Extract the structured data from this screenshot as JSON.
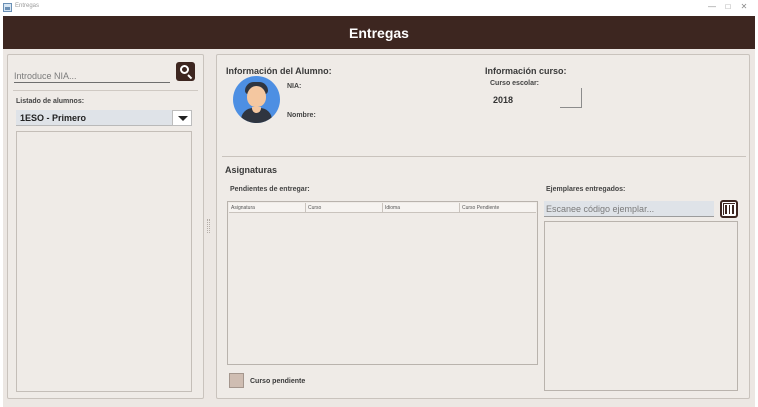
{
  "window": {
    "title": "Entregas",
    "controls": [
      "—",
      "□",
      "✕"
    ]
  },
  "header": {
    "title": "Entregas"
  },
  "left": {
    "nia_placeholder": "Introduce NIA...",
    "list_label": "Listado de alumnos:",
    "course_selected": "1ESO - Primero"
  },
  "student_info": {
    "title": "Información del Alumno:",
    "nia_label": "NIA:",
    "nombre_label": "Nombre:"
  },
  "course_info": {
    "title": "Información curso:",
    "year_label": "Curso escolar:",
    "year_value": "2018"
  },
  "subjects": {
    "title": "Asignaturas",
    "pending_label": "Pendientes de entregar:",
    "columns": [
      "Asignatura",
      "Curso",
      "Idioma",
      "Curso Pendiente"
    ],
    "legend_label": "Curso pendiente"
  },
  "delivered": {
    "label": "Ejemplares entregados:",
    "scan_placeholder": "Escanee código ejemplar..."
  },
  "colors": {
    "header_bg": "#3d2620",
    "panel_bg": "#efebe7",
    "input_bg": "#dfe3e8",
    "legend_swatch": "#cfbdb2",
    "avatar_bg": "#4d8fe3"
  },
  "icons": [
    "app-icon",
    "search-icon",
    "chevron-down-icon",
    "avatar",
    "barcode-scan-icon"
  ]
}
